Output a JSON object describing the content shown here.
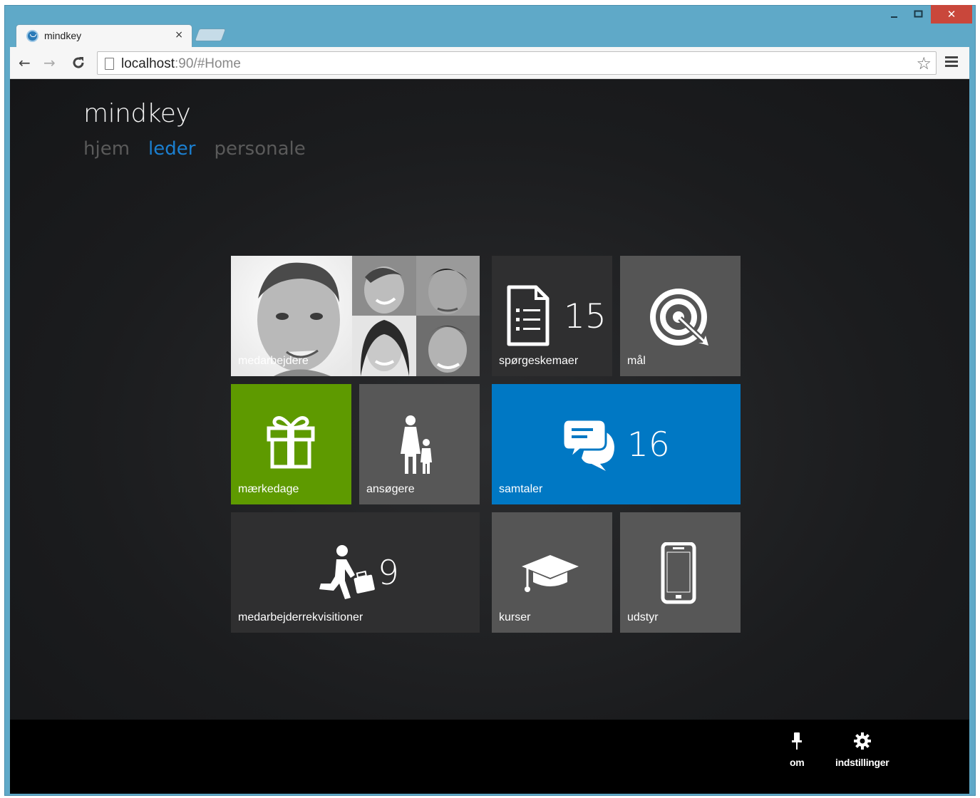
{
  "browser": {
    "tab_title": "mindkey",
    "tab_close": "×",
    "url_host": "localhost",
    "url_rest": ":90/#Home",
    "controls": {
      "minimize": "▁",
      "maximize": "☐",
      "close": "✕"
    },
    "nav": {
      "back": "←",
      "forward": "→",
      "reload": "C",
      "star": "☆",
      "menu": "≡"
    },
    "icons": [
      "favicon-icon",
      "page-icon",
      "star-icon",
      "menu-icon"
    ]
  },
  "app": {
    "title": "mindkey",
    "nav": [
      {
        "label": "hjem",
        "active": false
      },
      {
        "label": "leder",
        "active": true
      },
      {
        "label": "personale",
        "active": false
      }
    ]
  },
  "tiles": {
    "medarbejdere": {
      "label": "medarbejdere",
      "color": "#ffffff"
    },
    "spoergeskemaer": {
      "label": "spørgeskemaer",
      "count": "15",
      "icon": "document-list-icon",
      "color": "#2f2f30"
    },
    "maal": {
      "label": "mål",
      "icon": "target-icon",
      "color": "#555555"
    },
    "maerkedage": {
      "label": "mærkedage",
      "icon": "gift-icon",
      "color": "#5e9a00"
    },
    "ansoegere": {
      "label": "ansøgere",
      "icon": "parent-child-icon",
      "color": "#575757"
    },
    "samtaler": {
      "label": "samtaler",
      "count": "16",
      "icon": "chat-bubbles-icon",
      "color": "#0078c4"
    },
    "rekvisitioner": {
      "label": "medarbejderrekvisitioner",
      "count": "9",
      "icon": "walking-briefcase-icon",
      "color": "#2f2f30"
    },
    "kurser": {
      "label": "kurser",
      "icon": "graduation-cap-icon",
      "color": "#555555"
    },
    "udstyr": {
      "label": "udstyr",
      "icon": "smartphone-icon",
      "color": "#575757"
    }
  },
  "footer": {
    "om": "om",
    "indstillinger": "indstillinger"
  }
}
